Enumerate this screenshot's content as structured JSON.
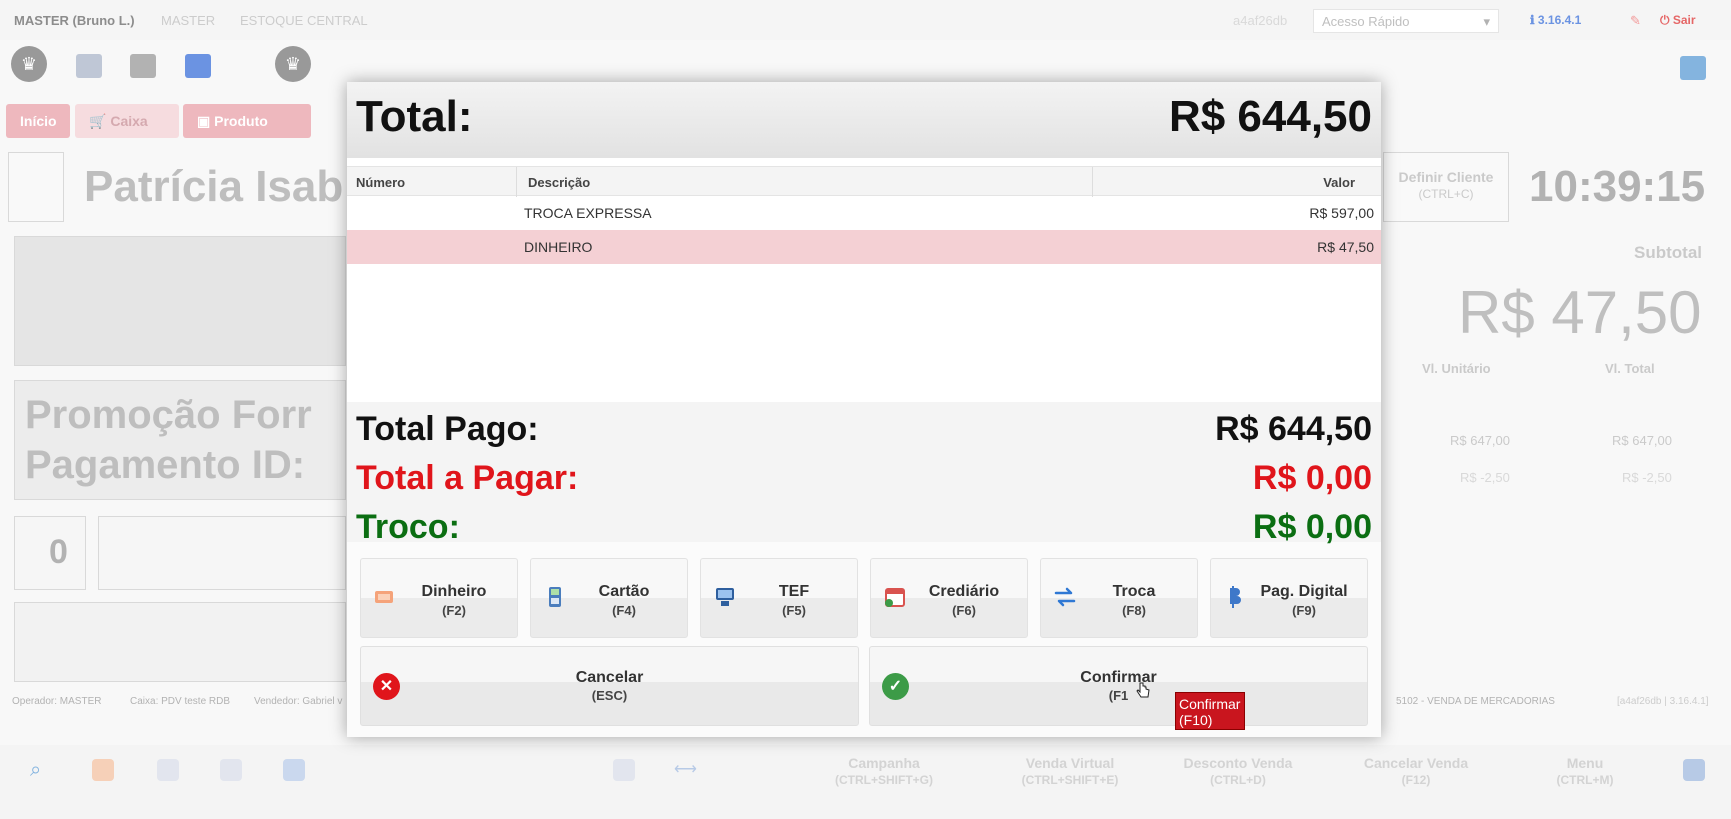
{
  "topbar": {
    "user": "MASTER (Bruno L.)",
    "company": "MASTER",
    "stock": "ESTOQUE CENTRAL",
    "session_id": "a4af26db",
    "quick_access_placeholder": "Acesso Rápido",
    "version": "3.16.4.1",
    "exit_label": "Sair"
  },
  "tabs": [
    {
      "label": "Início"
    },
    {
      "label": "Caixa"
    },
    {
      "label": "Produto"
    }
  ],
  "background": {
    "customer_name": "Patrícia Isab",
    "define_customer": "Definir Cliente",
    "define_customer_key": "(CTRL+C)",
    "clock": "10:39:15",
    "subtotal_label": "Subtotal",
    "subtotal_value": "R$ 47,50",
    "col_unit": "Vl. Unitário",
    "col_total": "Vl. Total",
    "rows": [
      {
        "unit": "R$ 647,00",
        "total": "R$ 647,00"
      },
      {
        "unit": "R$ -2,50",
        "total": "R$ -2,50"
      }
    ],
    "promo_line1": "Promoção Forr",
    "promo_line2": "Pagamento ID:",
    "qty": "0",
    "status": {
      "operator": "Operador: MASTER",
      "cashier": "Caixa: PDV teste RDB",
      "seller": "Vendedor: Gabriel v",
      "cfop": "5102 - VENDA DE MERCADORIAS",
      "footer_id": "[a4af26db | 3.16.4.1]"
    }
  },
  "bottombar": [
    {
      "label": "Campanha",
      "key": "(CTRL+SHIFT+G)"
    },
    {
      "label": "Venda Virtual",
      "key": "(CTRL+SHIFT+E)"
    },
    {
      "label": "Desconto Venda",
      "key": "(CTRL+D)"
    },
    {
      "label": "Cancelar Venda",
      "key": "(F12)"
    },
    {
      "label": "Menu",
      "key": "(CTRL+M)"
    }
  ],
  "modal": {
    "total_label": "Total:",
    "total_value": "R$ 644,50",
    "columns": {
      "numero": "Número",
      "descricao": "Descrição",
      "valor": "Valor"
    },
    "payments": [
      {
        "descricao": "TROCA EXPRESSA",
        "valor": "R$ 597,00"
      },
      {
        "descricao": "DINHEIRO",
        "valor": "R$ 47,50"
      }
    ],
    "total_pago_label": "Total Pago:",
    "total_pago_value": "R$ 644,50",
    "total_a_pagar_label": "Total a Pagar:",
    "total_a_pagar_value": "R$ 0,00",
    "troco_label": "Troco:",
    "troco_value": "R$ 0,00",
    "payment_buttons": [
      {
        "label": "Dinheiro",
        "key": "(F2)"
      },
      {
        "label": "Cartão",
        "key": "(F4)"
      },
      {
        "label": "TEF",
        "key": "(F5)"
      },
      {
        "label": "Crediário",
        "key": "(F6)"
      },
      {
        "label": "Troca",
        "key": "(F8)"
      },
      {
        "label": "Pag. Digital",
        "key": "(F9)"
      }
    ],
    "cancel": {
      "label": "Cancelar",
      "key": "(ESC)"
    },
    "confirm": {
      "label": "Confirmar",
      "key": "(F10)",
      "key_partial": "(F1"
    },
    "tooltip_line1": "Confirmar",
    "tooltip_line2": "(F10)"
  },
  "colors": {
    "red": "#e0151b",
    "green": "#0b6e12",
    "accent_pink": "#e8a0a8"
  }
}
